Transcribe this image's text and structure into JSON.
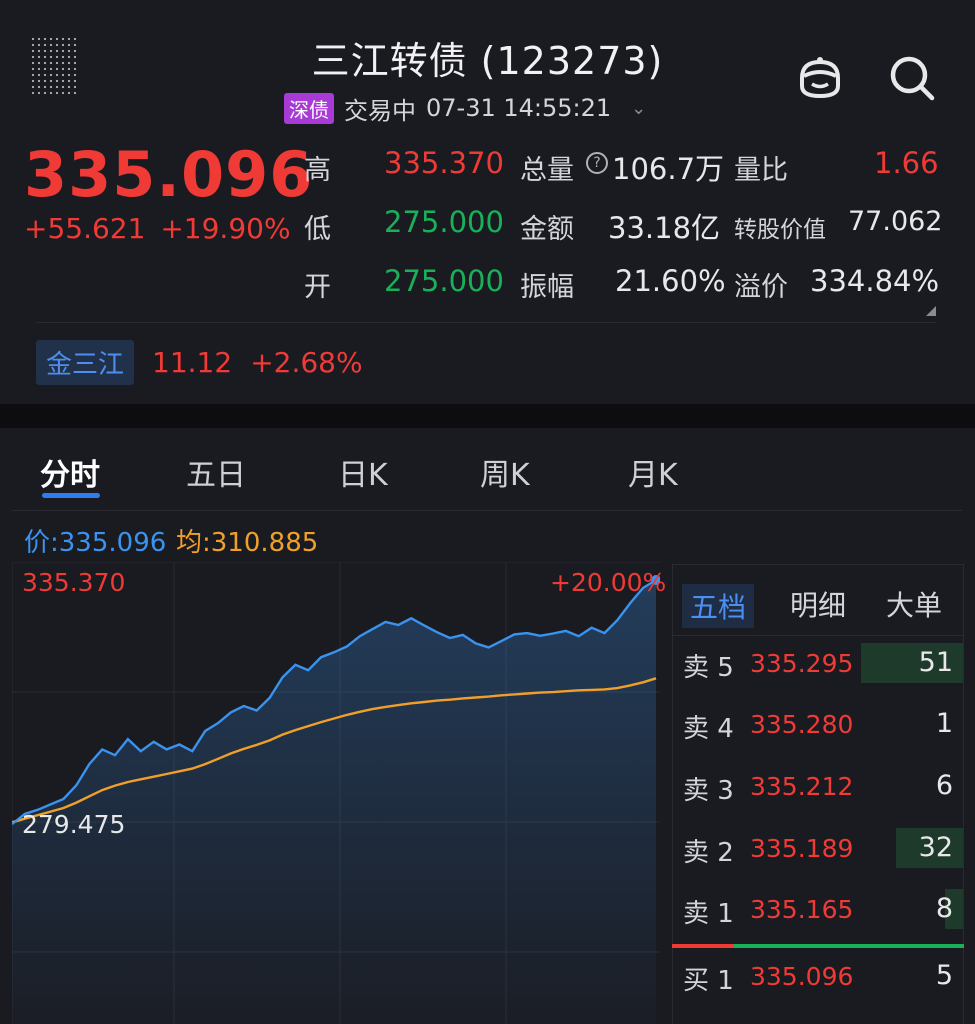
{
  "header": {
    "title": "三江转债 (123273)",
    "exchange_badge": "深债",
    "status": "交易中",
    "datetime": "07-31 14:55:21"
  },
  "quote": {
    "price": "335.096",
    "change": "+55.621",
    "change_pct": "+19.90%",
    "stats": [
      {
        "label": "高",
        "value": "335.370",
        "color": "red"
      },
      {
        "label": "低",
        "value": "275.000",
        "color": "green"
      },
      {
        "label": "开",
        "value": "275.000",
        "color": "green"
      },
      {
        "label": "总量",
        "value": "106.7万",
        "color": "neutral"
      },
      {
        "label": "金额",
        "value": "33.18亿",
        "color": "neutral"
      },
      {
        "label": "振幅",
        "value": "21.60%",
        "color": "neutral"
      },
      {
        "label": "量比",
        "value": "1.66",
        "color": "red"
      },
      {
        "label": "转股价值",
        "value": "77.062",
        "color": "neutral"
      },
      {
        "label": "溢价",
        "value": "334.84%",
        "color": "neutral"
      }
    ],
    "help_icon": "?"
  },
  "underlying": {
    "name": "金三江",
    "price": "11.12",
    "change_pct": "+2.68%"
  },
  "tabs": [
    "分时",
    "五日",
    "日K",
    "周K",
    "月K"
  ],
  "chart_info": {
    "price_label": "价:335.096",
    "avg_label": "均:310.885"
  },
  "chart_data": {
    "type": "line",
    "y_top_label": "335.370",
    "y_bottom_label": "279.475",
    "pct_top_label": "+20.00%",
    "ylim": [
      279.475,
      335.37
    ],
    "series": [
      {
        "name": "价",
        "color": "#3a93ef",
        "values": [
          280.8,
          283.1,
          284.0,
          285.2,
          286.4,
          289.5,
          294.2,
          297.5,
          296.2,
          299.8,
          297.1,
          299.2,
          297.5,
          298.6,
          297.1,
          301.6,
          303.4,
          305.8,
          307.2,
          306.2,
          309.0,
          313.6,
          316.4,
          315.2,
          318.1,
          319.2,
          320.5,
          322.8,
          324.4,
          326.0,
          325.3,
          326.8,
          325.2,
          323.7,
          322.4,
          323.1,
          321.2,
          320.3,
          321.7,
          323.2,
          323.5,
          322.9,
          323.4,
          324.0,
          322.8,
          324.7,
          323.5,
          326.4,
          330.2,
          333.6,
          335.37
        ]
      },
      {
        "name": "均",
        "color": "#f0a02a",
        "values": [
          281.2,
          282.0,
          282.8,
          283.6,
          284.4,
          285.6,
          287.0,
          288.4,
          289.4,
          290.2,
          290.8,
          291.4,
          292.0,
          292.6,
          293.2,
          294.2,
          295.4,
          296.6,
          297.6,
          298.5,
          299.5,
          300.8,
          301.8,
          302.7,
          303.6,
          304.4,
          305.2,
          305.9,
          306.5,
          307.0,
          307.4,
          307.8,
          308.1,
          308.4,
          308.6,
          308.9,
          309.1,
          309.3,
          309.6,
          309.8,
          310.0,
          310.2,
          310.3,
          310.5,
          310.7,
          310.8,
          310.9,
          311.2,
          311.8,
          312.5,
          313.4
        ]
      }
    ]
  },
  "order_book": {
    "tabs": [
      "五档",
      "明细",
      "大单"
    ],
    "asks": [
      {
        "label": "卖 5",
        "price": "335.295",
        "volume": "51",
        "bar": 0.35
      },
      {
        "label": "卖 4",
        "price": "335.280",
        "volume": "1",
        "bar": 0.0
      },
      {
        "label": "卖 3",
        "price": "335.212",
        "volume": "6",
        "bar": 0.0
      },
      {
        "label": "卖 2",
        "price": "335.189",
        "volume": "32",
        "bar": 0.23
      },
      {
        "label": "卖 1",
        "price": "335.165",
        "volume": "8",
        "bar": 0.06
      }
    ],
    "bids": [
      {
        "label": "买 1",
        "price": "335.096",
        "volume": "5",
        "bar": 0.0
      }
    ]
  }
}
